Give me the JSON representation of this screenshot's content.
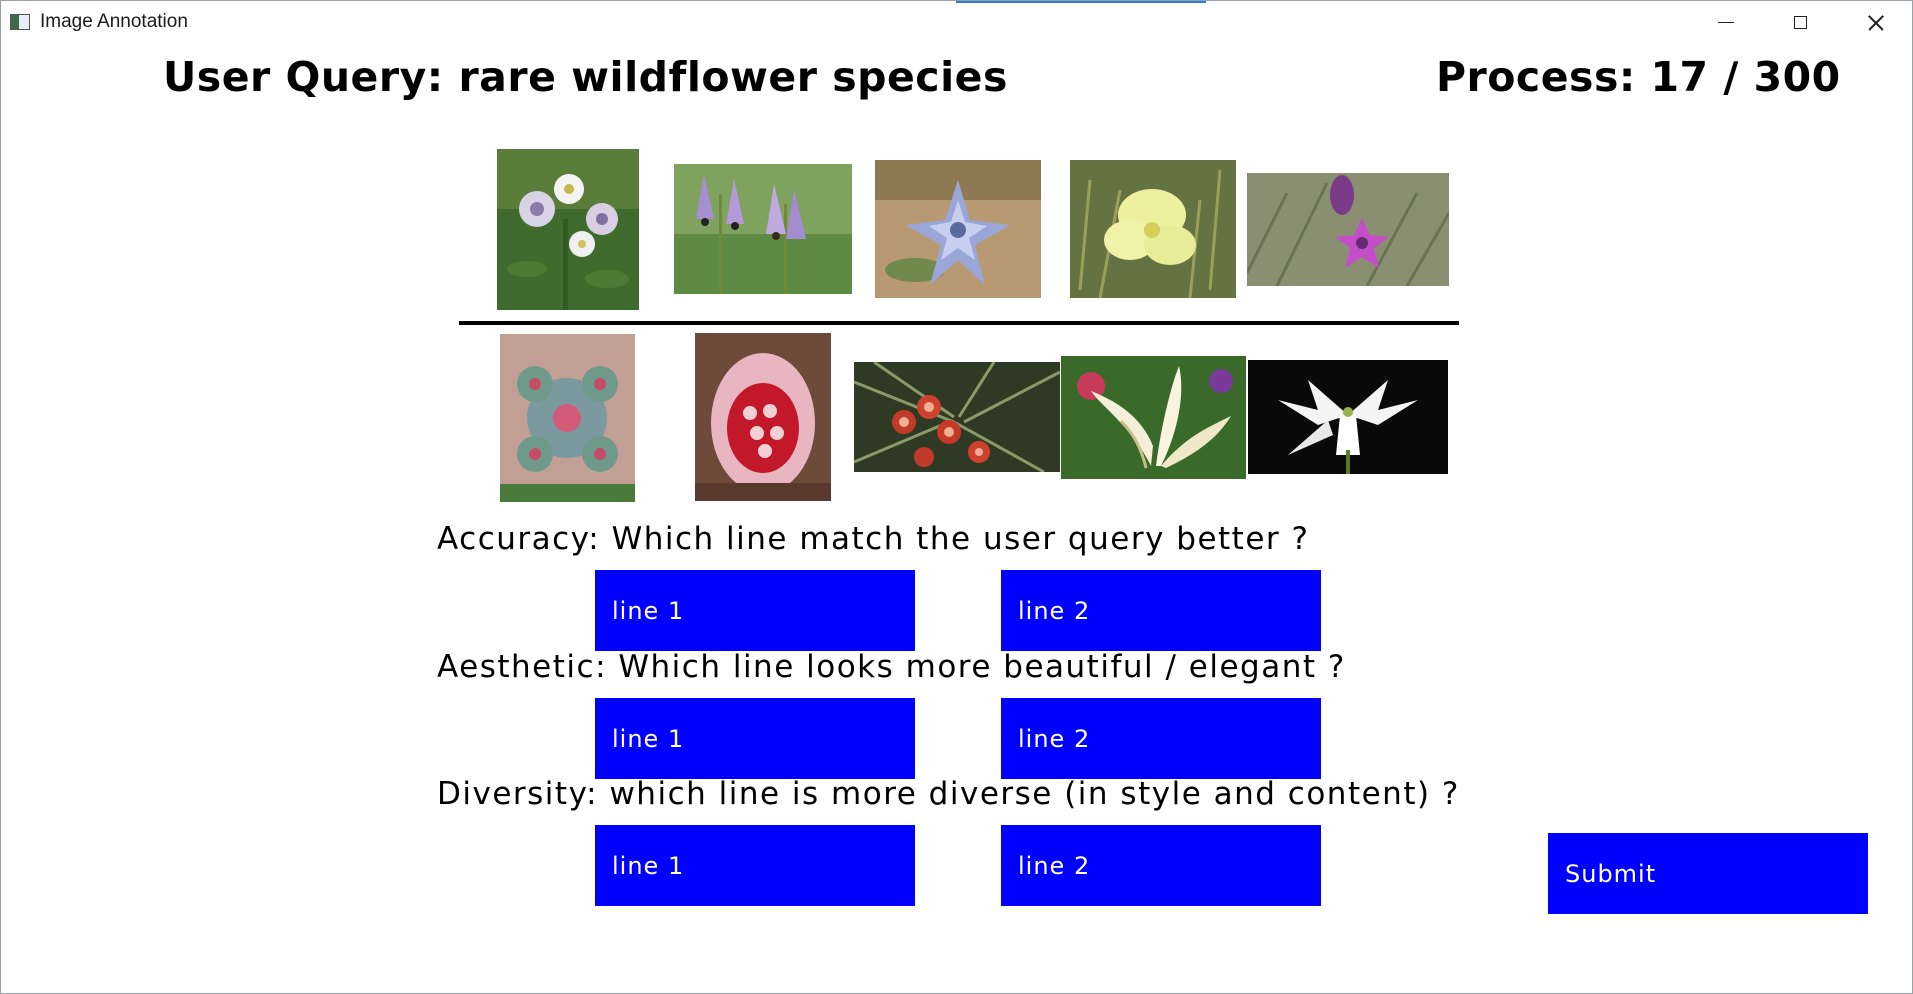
{
  "window": {
    "title": "Image Annotation",
    "icon": "app-window-icon",
    "controls": [
      "minimize-icon",
      "maximize-icon",
      "close-icon"
    ]
  },
  "header": {
    "query_text": "User Query: rare wildflower species",
    "process_text": "Process: 17 / 300",
    "process_current": 17,
    "process_total": 300
  },
  "lines": [
    {
      "name": "line 1",
      "images": [
        "white-lavender-flowers",
        "purple-shooting-star-flowers",
        "blue-star-flower",
        "yellow-primrose",
        "magenta-star-flower"
      ]
    },
    {
      "name": "line 2",
      "images": [
        "fractal-flower-art",
        "pink-red-bloom",
        "orange-red-orchids",
        "white-trumpet-lily",
        "white-egret-orchid"
      ]
    }
  ],
  "questions": [
    {
      "id": "accuracy",
      "text": "Accuracy: Which line match the user query better ?",
      "option_1": "line 1",
      "option_2": "line 2"
    },
    {
      "id": "aesthetic",
      "text": "Aesthetic: Which line looks more beautiful / elegant ?",
      "option_1": "line 1",
      "option_2": "line 2"
    },
    {
      "id": "diversity",
      "text": "Diversity: which line is more diverse (in style and content) ?",
      "option_1": "line 1",
      "option_2": "line 2"
    }
  ],
  "submit_label": "Submit",
  "colors": {
    "button_bg": "#0000ff",
    "button_text": "#ffffff",
    "divider": "#000000",
    "background": "#ffffff"
  }
}
